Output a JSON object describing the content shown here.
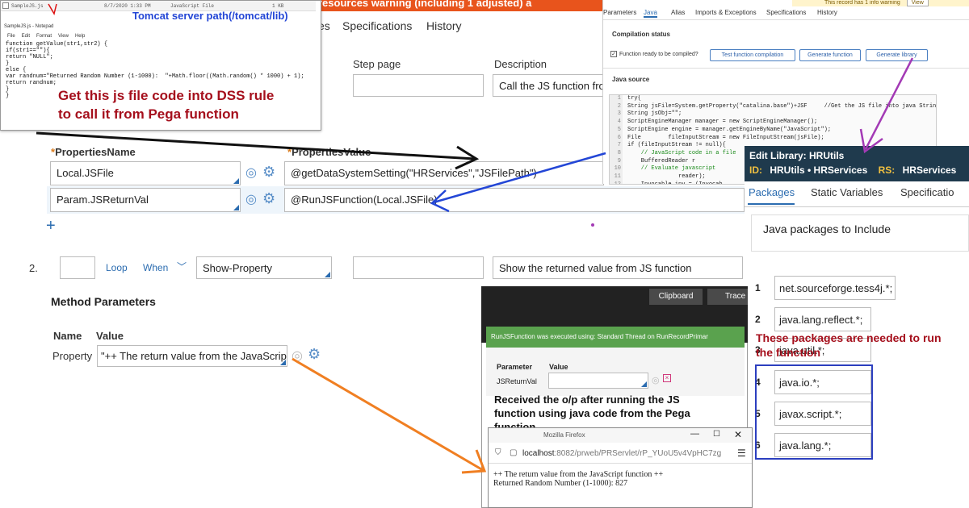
{
  "notepad": {
    "file_strip": {
      "name": "SampleJS.js",
      "date": "8/7/2020 1:33 PM",
      "type": "JavaScript File",
      "size": "1 KB"
    },
    "title": "SampleJS.js - Notepad",
    "menu": [
      "File",
      "Edit",
      "Format",
      "View",
      "Help"
    ],
    "code": "function getValue(str1,str2) {\nif(str1==\"\"){\nreturn \"NULL\";\n}\nelse {\nvar randnum=\"Returned Random Number (1-1000):  \"+Math.floor((Math.random() * 1000) + 1);\nreturn randnum;\n}\n}"
  },
  "annotations": {
    "tomcat_path": "Tomcat server path(/tomcat/lib)",
    "get_js": "Get this js file code into DSS rule\nto call it from Pega function",
    "packages_needed": "These packages are needed to run\nthe function",
    "received_output": "Received the o/p after running the JS\nfunction using java code from the Pega\nfunction"
  },
  "background_form": {
    "top_banner": "resources warning (including 1 adjusted) a",
    "tabs": [
      "es",
      "Specifications",
      "History"
    ],
    "col_step_page": "Step page",
    "col_description": "Description",
    "desc_value": "Call the JS function fror",
    "properties_name_header": "PropertiesName",
    "properties_value_header": "PropertiesValue",
    "rows": [
      {
        "name": "Local.JSFile",
        "value": "@getDataSystemSetting(\"HRServices\",\"JSFilePath\")"
      },
      {
        "name": "Param.JSReturnVal",
        "value": "@RunJSFunction(Local.JSFile)"
      }
    ],
    "step_number": "2.",
    "loop": "Loop",
    "when": "When",
    "method": "Show-Property",
    "step2_desc": "Show the returned value from JS function",
    "method_params": "Method Parameters",
    "mp_name": "Name",
    "mp_value": "Value",
    "mp_row_name": "Property",
    "mp_row_value": "\"++ The return value from the JavaScript"
  },
  "java_panel": {
    "warning": "This record has 1 info warning",
    "view": "View",
    "tabs": [
      "Parameters",
      "Java",
      "Alias",
      "Imports & Exceptions",
      "Specifications",
      "History"
    ],
    "compilation_status": "Compilation status",
    "ready_label": "Function ready to be compiled?",
    "buttons": [
      "Test function compilation",
      "Generate function",
      "Generate library"
    ],
    "java_source": "Java source",
    "code_lines": [
      {
        "n": "1",
        "t": "try{"
      },
      {
        "n": "2",
        "t": "String jsFile=System.getProperty(\"catalina.base\")+JSF     //Get the JS file into java String"
      },
      {
        "n": "3",
        "t": "String jsObj=\"\";"
      },
      {
        "n": "4",
        "t": "ScriptEngineManager manager = new ScriptEngineManager();"
      },
      {
        "n": "5",
        "t": "ScriptEngine engine = manager.getEngineByName(\"JavaScript\");"
      },
      {
        "n": "6",
        "t": "File        fileInputStream = new FileInputStream(jsFile);"
      },
      {
        "n": "7",
        "t": "if (fileInputStream != null){"
      },
      {
        "n": "8",
        "t": "    // JavaScript code in a file"
      },
      {
        "n": "9",
        "t": "    BufferedReader r"
      },
      {
        "n": "10",
        "t": "    // Evaluate javascript"
      },
      {
        "n": "11",
        "t": "               reader);"
      },
      {
        "n": "12",
        "t": "    Invocable inv = (Invocab"
      }
    ]
  },
  "library_panel": {
    "title": "Edit  Library: HRUtils",
    "id_label": "ID:",
    "id_value": "HRUtils • HRServices",
    "rs_label": "RS:",
    "rs_value": "HRServices",
    "tabs": [
      "Packages",
      "Static Variables",
      "Specificatio"
    ],
    "section_title": "Java packages to Include",
    "packages": [
      {
        "n": "1",
        "p": "net.sourceforge.tess4j.*;"
      },
      {
        "n": "2",
        "p": "java.lang.reflect.*;"
      },
      {
        "n": "3",
        "p": "java.util.*;"
      },
      {
        "n": "4",
        "p": "java.io.*;"
      },
      {
        "n": "5",
        "p": "javax.script.*;"
      },
      {
        "n": "6",
        "p": "java.lang.*;"
      }
    ]
  },
  "tracer": {
    "clipboard": "Clipboard",
    "tracer": "Trace",
    "message": "RunJSFunction was executed using: Standard Thread on RunRecordPrimar",
    "param_header": "Parameter",
    "value_header": "Value",
    "param_name": "JSReturnVal"
  },
  "browser": {
    "tab_title": "Mozilla Firefox",
    "url_host": "localhost",
    "url_rest": ":8082/prweb/PRServlet/rP_YUoU5v4VpHC7zg",
    "line1": "++ The return value from the JavaScript function ++",
    "line2": "Returned Random Number (1-1000): 827"
  },
  "colors": {
    "orange": "#e8541c",
    "pega_blue": "#2b6cb0",
    "annotation_red": "#a50f1c",
    "library_header": "#1f3a4d",
    "tracer_green": "#5aa24e"
  }
}
